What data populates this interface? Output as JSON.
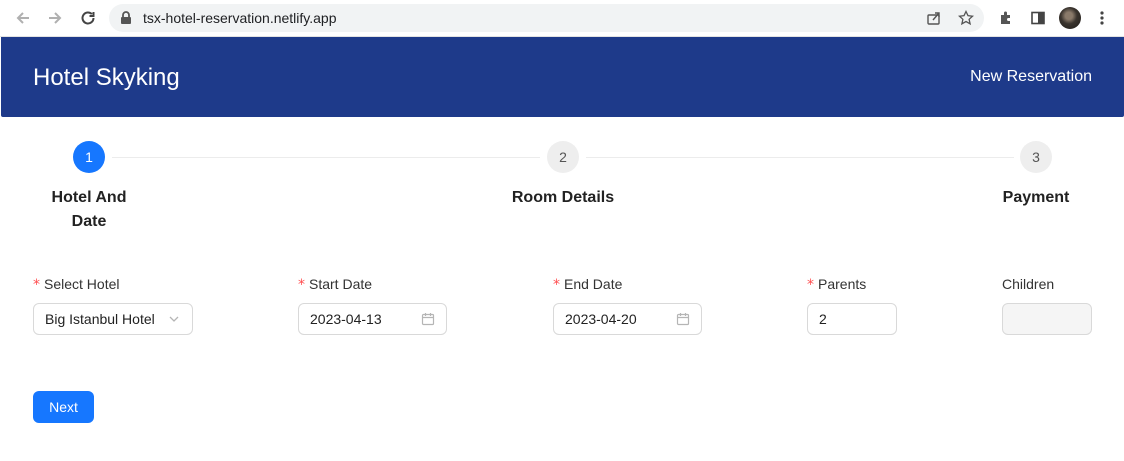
{
  "browser": {
    "url": "tsx-hotel-reservation.netlify.app",
    "back_icon": "arrow-left-icon",
    "forward_icon": "arrow-right-icon",
    "reload_icon": "reload-icon",
    "lock_icon": "lock-icon"
  },
  "header": {
    "brand": "Hotel Skyking",
    "nav_link": "New Reservation",
    "bg_color": "#1e3a8a"
  },
  "stepper": {
    "current": 1,
    "steps": [
      {
        "number": "1",
        "title": "Hotel And Date"
      },
      {
        "number": "2",
        "title": "Room Details"
      },
      {
        "number": "3",
        "title": "Payment"
      }
    ],
    "active_color": "#1677ff"
  },
  "form": {
    "hotel": {
      "label": "Select Hotel",
      "required": "*",
      "value": "Big Istanbul Hotel"
    },
    "start_date": {
      "label": "Start Date",
      "required": "*",
      "value": "2023-04-13"
    },
    "end_date": {
      "label": "End Date",
      "required": "*",
      "value": "2023-04-20"
    },
    "parents": {
      "label": "Parents",
      "required": "*",
      "value": "2"
    },
    "children": {
      "label": "Children",
      "value": ""
    }
  },
  "actions": {
    "next_label": "Next"
  }
}
